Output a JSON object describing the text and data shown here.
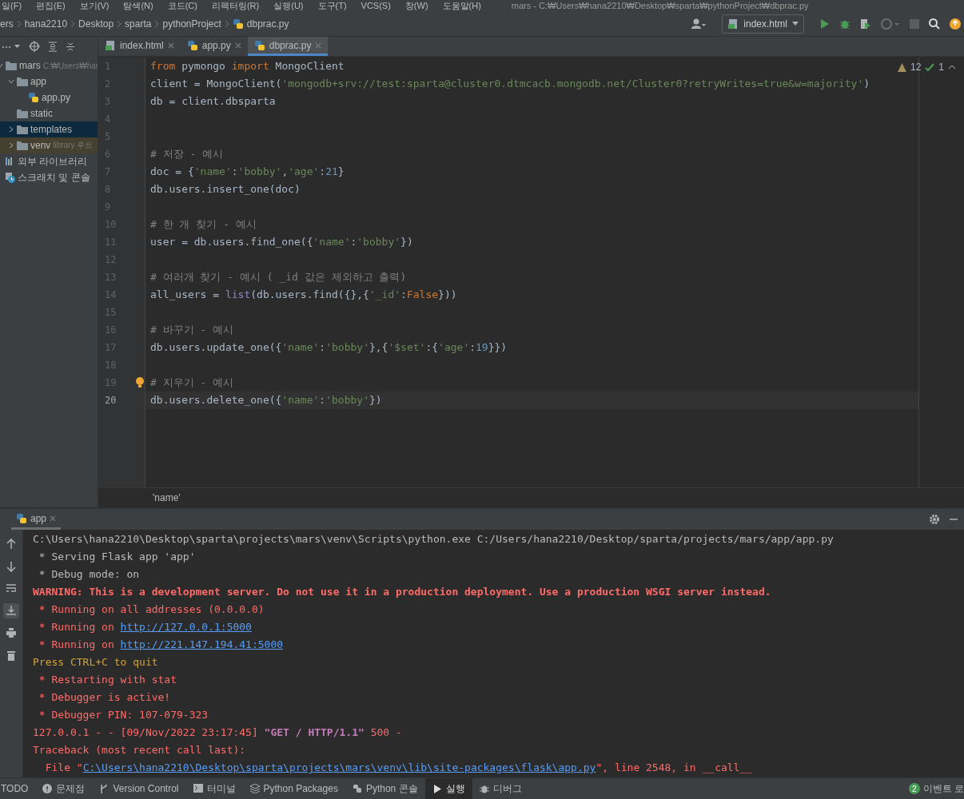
{
  "menu": [
    {
      "label": "일(F)"
    },
    {
      "label": "편집(E)"
    },
    {
      "label": "보기(V)"
    },
    {
      "label": "탐색(N)"
    },
    {
      "label": "코드(C)"
    },
    {
      "label": "리팩터링(R)"
    },
    {
      "label": "실행(U)"
    },
    {
      "label": "도구(T)"
    },
    {
      "label": "VCS(S)"
    },
    {
      "label": "창(W)"
    },
    {
      "label": "도움말(H)"
    }
  ],
  "title": "mars - C:₩Users₩hana2210₩Desktop₩sparta₩pythonProject₩dbprac.py",
  "breadcrumb": [
    {
      "label": "ers",
      "kind": "folder"
    },
    {
      "label": "hana2210",
      "kind": "folder"
    },
    {
      "label": "Desktop",
      "kind": "folder"
    },
    {
      "label": "sparta",
      "kind": "folder"
    },
    {
      "label": "pythonProject",
      "kind": "folder"
    },
    {
      "label": "dbprac.py",
      "kind": "python"
    }
  ],
  "run_config": "index.html",
  "project": {
    "tree": [
      {
        "label": "mars",
        "note": "C:₩Users₩har",
        "kind": "folder",
        "selected": false,
        "expanded": true,
        "children": [
          {
            "label": "app",
            "kind": "folder",
            "selected": false,
            "expanded": true,
            "children": [
              {
                "label": "app.py",
                "kind": "python",
                "selected": false
              }
            ]
          },
          {
            "label": "static",
            "kind": "folder",
            "selected": false
          },
          {
            "label": "templates",
            "kind": "folder",
            "selected": true,
            "expanded": false
          },
          {
            "label": "venv",
            "note": "library 루트",
            "kind": "excluded",
            "selected": false,
            "expanded": false
          }
        ]
      },
      {
        "label": "외부 라이브러리",
        "kind": "library",
        "selected": false
      },
      {
        "label": "스크래치 및 콘솔",
        "kind": "scratch",
        "selected": false
      }
    ]
  },
  "editor": {
    "tabs": [
      {
        "label": "index.html",
        "kind": "html",
        "selected": false
      },
      {
        "label": "app.py",
        "kind": "python",
        "selected": false
      },
      {
        "label": "dbprac.py",
        "kind": "python",
        "selected": true
      }
    ],
    "warnings": "12",
    "typos": "1",
    "lines": [
      {
        "no": "1",
        "current": false,
        "bulb": false,
        "tokens": [
          {
            "kind": "kw",
            "text": "from"
          },
          {
            "kind": "id",
            "text": " pymongo "
          },
          {
            "kind": "kw",
            "text": "import"
          },
          {
            "kind": "id",
            "text": " MongoClient"
          }
        ]
      },
      {
        "no": "2",
        "current": false,
        "bulb": false,
        "tokens": [
          {
            "kind": "id",
            "text": "client = MongoClient("
          },
          {
            "kind": "str",
            "text": "'mongodb+srv://test:sparta@cluster0.dtmcacb.mongodb.net/Cluster0?retryWrites=true&w=majority'"
          },
          {
            "kind": "id",
            "text": ")"
          }
        ]
      },
      {
        "no": "3",
        "current": false,
        "bulb": false,
        "tokens": [
          {
            "kind": "id",
            "text": "db = client.dbsparta"
          }
        ]
      },
      {
        "no": "4",
        "current": false,
        "bulb": false
      },
      {
        "no": "5",
        "current": false,
        "bulb": false
      },
      {
        "no": "6",
        "current": false,
        "bulb": false,
        "tokens": [
          {
            "kind": "com",
            "text": "# 저장 - 예시"
          }
        ]
      },
      {
        "no": "7",
        "current": false,
        "bulb": false,
        "tokens": [
          {
            "kind": "id",
            "text": "doc = {"
          },
          {
            "kind": "str",
            "text": "'name'"
          },
          {
            "kind": "id",
            "text": ":"
          },
          {
            "kind": "str",
            "text": "'bobby'"
          },
          {
            "kind": "id",
            "text": ","
          },
          {
            "kind": "str",
            "text": "'age'"
          },
          {
            "kind": "id",
            "text": ":"
          },
          {
            "kind": "num",
            "text": "21"
          },
          {
            "kind": "id",
            "text": "}"
          }
        ]
      },
      {
        "no": "8",
        "current": false,
        "bulb": false,
        "tokens": [
          {
            "kind": "id",
            "text": "db.users.insert_one(doc)"
          }
        ]
      },
      {
        "no": "9",
        "current": false,
        "bulb": false
      },
      {
        "no": "10",
        "current": false,
        "bulb": false,
        "tokens": [
          {
            "kind": "com",
            "text": "# 한 개 찾기 - 예시"
          }
        ]
      },
      {
        "no": "11",
        "current": false,
        "bulb": false,
        "tokens": [
          {
            "kind": "id",
            "text": "user = db.users.find_one({"
          },
          {
            "kind": "str",
            "text": "'name'"
          },
          {
            "kind": "id",
            "text": ":"
          },
          {
            "kind": "str",
            "text": "'bobby'"
          },
          {
            "kind": "id",
            "text": "})"
          }
        ]
      },
      {
        "no": "12",
        "current": false,
        "bulb": false
      },
      {
        "no": "13",
        "current": false,
        "bulb": false,
        "tokens": [
          {
            "kind": "com",
            "text": "# 여러개 찾기 - 예시 ( _id 값은 제외하고 출력)"
          }
        ]
      },
      {
        "no": "14",
        "current": false,
        "bulb": false,
        "tokens": [
          {
            "kind": "id",
            "text": "all_users = "
          },
          {
            "kind": "bi",
            "text": "list"
          },
          {
            "kind": "id",
            "text": "(db.users.find({},{"
          },
          {
            "kind": "str",
            "text": "'_id'"
          },
          {
            "kind": "id",
            "text": ":"
          },
          {
            "kind": "kw",
            "text": "False"
          },
          {
            "kind": "id",
            "text": "}))"
          }
        ]
      },
      {
        "no": "15",
        "current": false,
        "bulb": false
      },
      {
        "no": "16",
        "current": false,
        "bulb": false,
        "tokens": [
          {
            "kind": "com",
            "text": "# 바꾸기 - 예시"
          }
        ]
      },
      {
        "no": "17",
        "current": false,
        "bulb": false,
        "tokens": [
          {
            "kind": "id",
            "text": "db.users.update_one({"
          },
          {
            "kind": "str",
            "text": "'name'"
          },
          {
            "kind": "id",
            "text": ":"
          },
          {
            "kind": "str",
            "text": "'bobby'"
          },
          {
            "kind": "id",
            "text": "},{"
          },
          {
            "kind": "str",
            "text": "'$set'"
          },
          {
            "kind": "id",
            "text": ":{"
          },
          {
            "kind": "str",
            "text": "'age'"
          },
          {
            "kind": "id",
            "text": ":"
          },
          {
            "kind": "num",
            "text": "19"
          },
          {
            "kind": "id",
            "text": "}})"
          }
        ]
      },
      {
        "no": "18",
        "current": false,
        "bulb": false
      },
      {
        "no": "19",
        "current": false,
        "bulb": true,
        "tokens": [
          {
            "kind": "com",
            "text": "# 지우기 - 예시"
          }
        ]
      },
      {
        "no": "20",
        "current": true,
        "bulb": false,
        "tokens": [
          {
            "kind": "id",
            "text": "db.users.delete_one({"
          },
          {
            "kind": "str",
            "text": "'name'"
          },
          {
            "kind": "id",
            "text": ":"
          },
          {
            "kind": "str",
            "text": "'bobby'"
          },
          {
            "kind": "id",
            "text": "})"
          }
        ]
      }
    ],
    "breadcrumb": "'name'"
  },
  "run": {
    "tab": "app",
    "tools": [
      {
        "kind": "up",
        "selected": false
      },
      {
        "kind": "down",
        "selected": false
      },
      {
        "kind": "wrap",
        "selected": false
      },
      {
        "kind": "scroll",
        "selected": true
      },
      {
        "kind": "print",
        "selected": false
      },
      {
        "kind": "trash",
        "selected": false
      }
    ],
    "console": [
      [
        {
          "kind": "plain",
          "text": "C:\\Users\\hana2210\\Desktop\\sparta\\projects\\mars\\venv\\Scripts\\python.exe C:/Users/hana2210/Desktop/sparta/projects/mars/app/app.py"
        }
      ],
      [
        {
          "kind": "plain",
          "text": " * Serving Flask app 'app'"
        }
      ],
      [
        {
          "kind": "plain",
          "text": " * Debug mode: on"
        }
      ],
      [
        {
          "kind": "errb",
          "text": "WARNING: This is a development server. Do not use it in a production deployment. Use a production WSGI server instead."
        }
      ],
      [
        {
          "kind": "err",
          "text": " * Running on all addresses (0.0.0.0)"
        }
      ],
      [
        {
          "kind": "err",
          "text": " * Running on "
        },
        {
          "kind": "link",
          "text": "http://127.0.0.1:5000"
        }
      ],
      [
        {
          "kind": "err",
          "text": " * Running on "
        },
        {
          "kind": "link",
          "text": "http://221.147.194.41:5000"
        }
      ],
      [
        {
          "kind": "warn",
          "text": "Press CTRL+C to quit"
        }
      ],
      [
        {
          "kind": "err",
          "text": " * Restarting with stat"
        }
      ],
      [
        {
          "kind": "err",
          "text": " * Debugger is active!"
        }
      ],
      [
        {
          "kind": "err",
          "text": " * Debugger PIN: 107-079-323"
        }
      ],
      [
        {
          "kind": "err",
          "text": "127.0.0.1 - - [09/Nov/2022 23:17:45] "
        },
        {
          "kind": "purple",
          "text": "\"GET / HTTP/1.1\""
        },
        {
          "kind": "err",
          "text": " 500 -"
        }
      ],
      [
        {
          "kind": "err",
          "text": "Traceback (most recent call last):"
        }
      ],
      [
        {
          "kind": "err",
          "text": "  File \""
        },
        {
          "kind": "link",
          "text": "C:\\Users\\hana2210\\Desktop\\sparta\\projects\\mars\\venv\\lib\\site-packages\\flask\\app.py"
        },
        {
          "kind": "err",
          "text": "\", line 2548, in __call__"
        }
      ]
    ]
  },
  "tool_windows": [
    {
      "label": "TODO",
      "kind": "todo",
      "selected": false
    },
    {
      "label": "문제점",
      "kind": "problems",
      "selected": false
    },
    {
      "label": "Version Control",
      "kind": "vcs",
      "selected": false
    },
    {
      "label": "터미널",
      "kind": "terminal",
      "selected": false
    },
    {
      "label": "Python Packages",
      "kind": "packages",
      "selected": false
    },
    {
      "label": "Python 콘솔",
      "kind": "console",
      "selected": false
    },
    {
      "label": "실행",
      "kind": "run",
      "selected": true
    },
    {
      "label": "디버그",
      "kind": "debug",
      "selected": false
    }
  ],
  "events": {
    "count": "2",
    "label": "이벤트 로"
  }
}
